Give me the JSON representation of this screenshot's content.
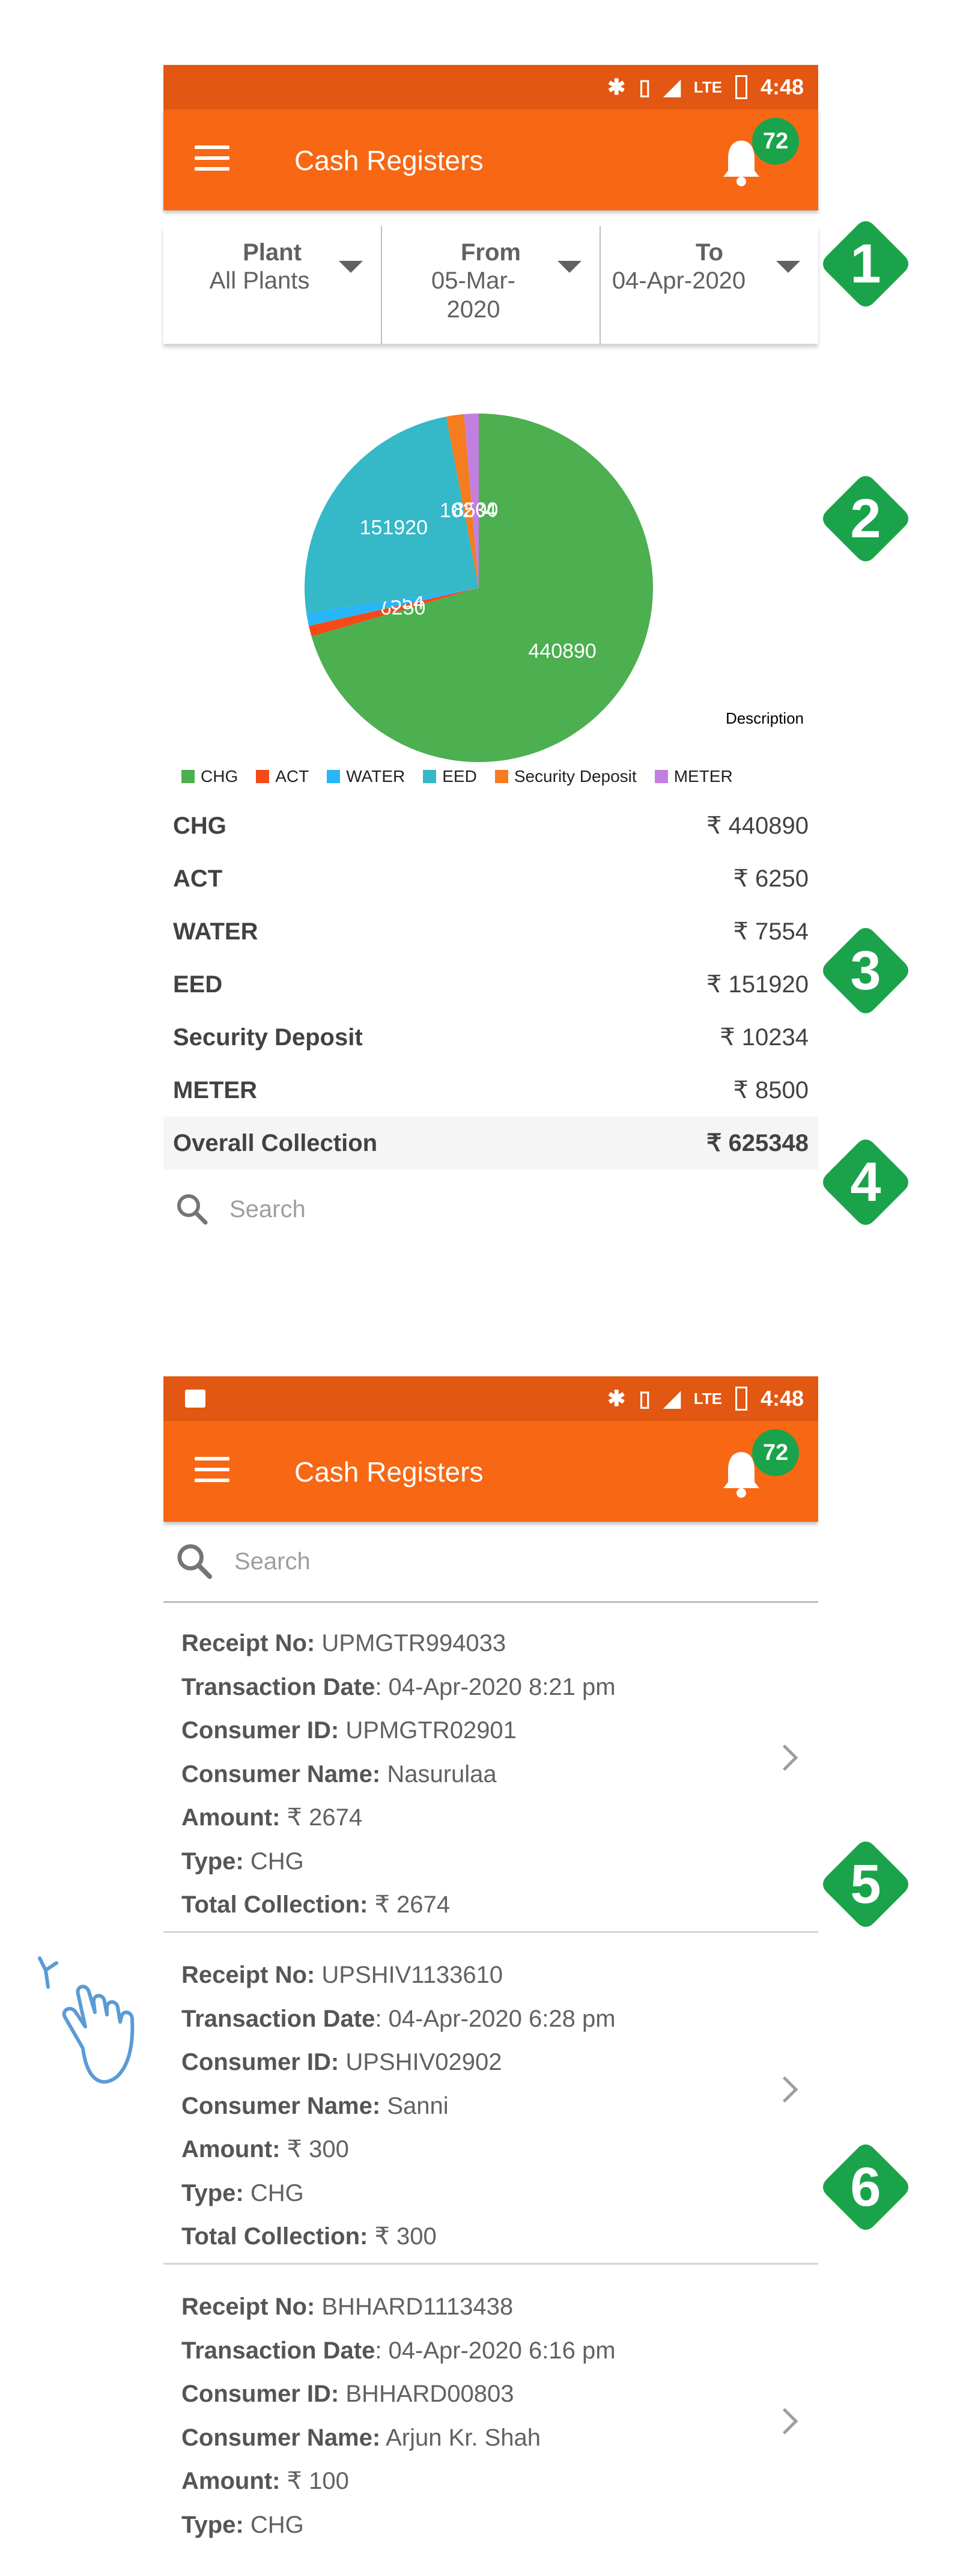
{
  "status_bar": {
    "time": "4:48",
    "network": "LTE"
  },
  "app": {
    "title": "Cash Registers",
    "notification_count": "72"
  },
  "filters": [
    {
      "label": "Plant",
      "value": "All Plants"
    },
    {
      "label": "From",
      "value": "05-Mar-2020"
    },
    {
      "label": "To",
      "value": "04-Apr-2020"
    }
  ],
  "chart_data": {
    "type": "pie",
    "description_label": "Description",
    "slices": [
      {
        "name": "CHG",
        "value": 440890,
        "label": "440890",
        "color": "#4caf50"
      },
      {
        "name": "ACT",
        "value": 6250,
        "label": "6250",
        "color": "#f44a16"
      },
      {
        "name": "WATER",
        "value": 7554,
        "label": "7554",
        "color": "#29b6f6"
      },
      {
        "name": "EED",
        "value": 151920,
        "label": "151920",
        "color": "#35b8c7"
      },
      {
        "name": "Security Deposit",
        "value": 10234,
        "label": "10234",
        "color": "#f57c1f"
      },
      {
        "name": "METER",
        "value": 8500,
        "label": "8500",
        "color": "#c27fe0"
      }
    ]
  },
  "summary": {
    "rows": [
      {
        "name": "CHG",
        "amount": "₹ 440890"
      },
      {
        "name": "ACT",
        "amount": "₹ 6250"
      },
      {
        "name": "WATER",
        "amount": "₹ 7554"
      },
      {
        "name": "EED",
        "amount": "₹ 151920"
      },
      {
        "name": "Security Deposit",
        "amount": "₹ 10234"
      },
      {
        "name": "METER",
        "amount": "₹ 8500"
      }
    ],
    "total_label": "Overall Collection",
    "total_amount": "₹ 625348"
  },
  "search": {
    "placeholder": "Search"
  },
  "receipt_labels": {
    "receipt_no": "Receipt No:",
    "date": "Transaction Date",
    "consumer_id": "Consumer ID:",
    "consumer_name": "Consumer Name:",
    "amount": "Amount:",
    "type": "Type:",
    "total": "Total Collection:"
  },
  "receipts": [
    {
      "receipt_no": "UPMGTR994033",
      "date": ": 04-Apr-2020 8:21 pm",
      "consumer_id": "UPMGTR02901",
      "consumer_name": "Nasurulaa",
      "amount": "₹ 2674",
      "type": "CHG",
      "total": "₹ 2674"
    },
    {
      "receipt_no": "UPSHIV1133610",
      "date": ": 04-Apr-2020 6:28 pm",
      "consumer_id": "UPSHIV02902",
      "consumer_name": "Sanni",
      "amount": "₹ 300",
      "type": "CHG",
      "total": "₹ 300"
    },
    {
      "receipt_no": "BHHARD1113438",
      "date": ": 04-Apr-2020 6:16 pm",
      "consumer_id": "BHHARD00803",
      "consumer_name": "Arjun Kr. Shah",
      "amount": "₹ 100",
      "type": "CHG",
      "total": ""
    }
  ],
  "markers": [
    "1",
    "2",
    "3",
    "4",
    "5",
    "6"
  ],
  "colors": {
    "statusbar": "#e25712",
    "appbar": "#f76714",
    "badge": "#1aa34a",
    "marker": "#1aa34a"
  }
}
